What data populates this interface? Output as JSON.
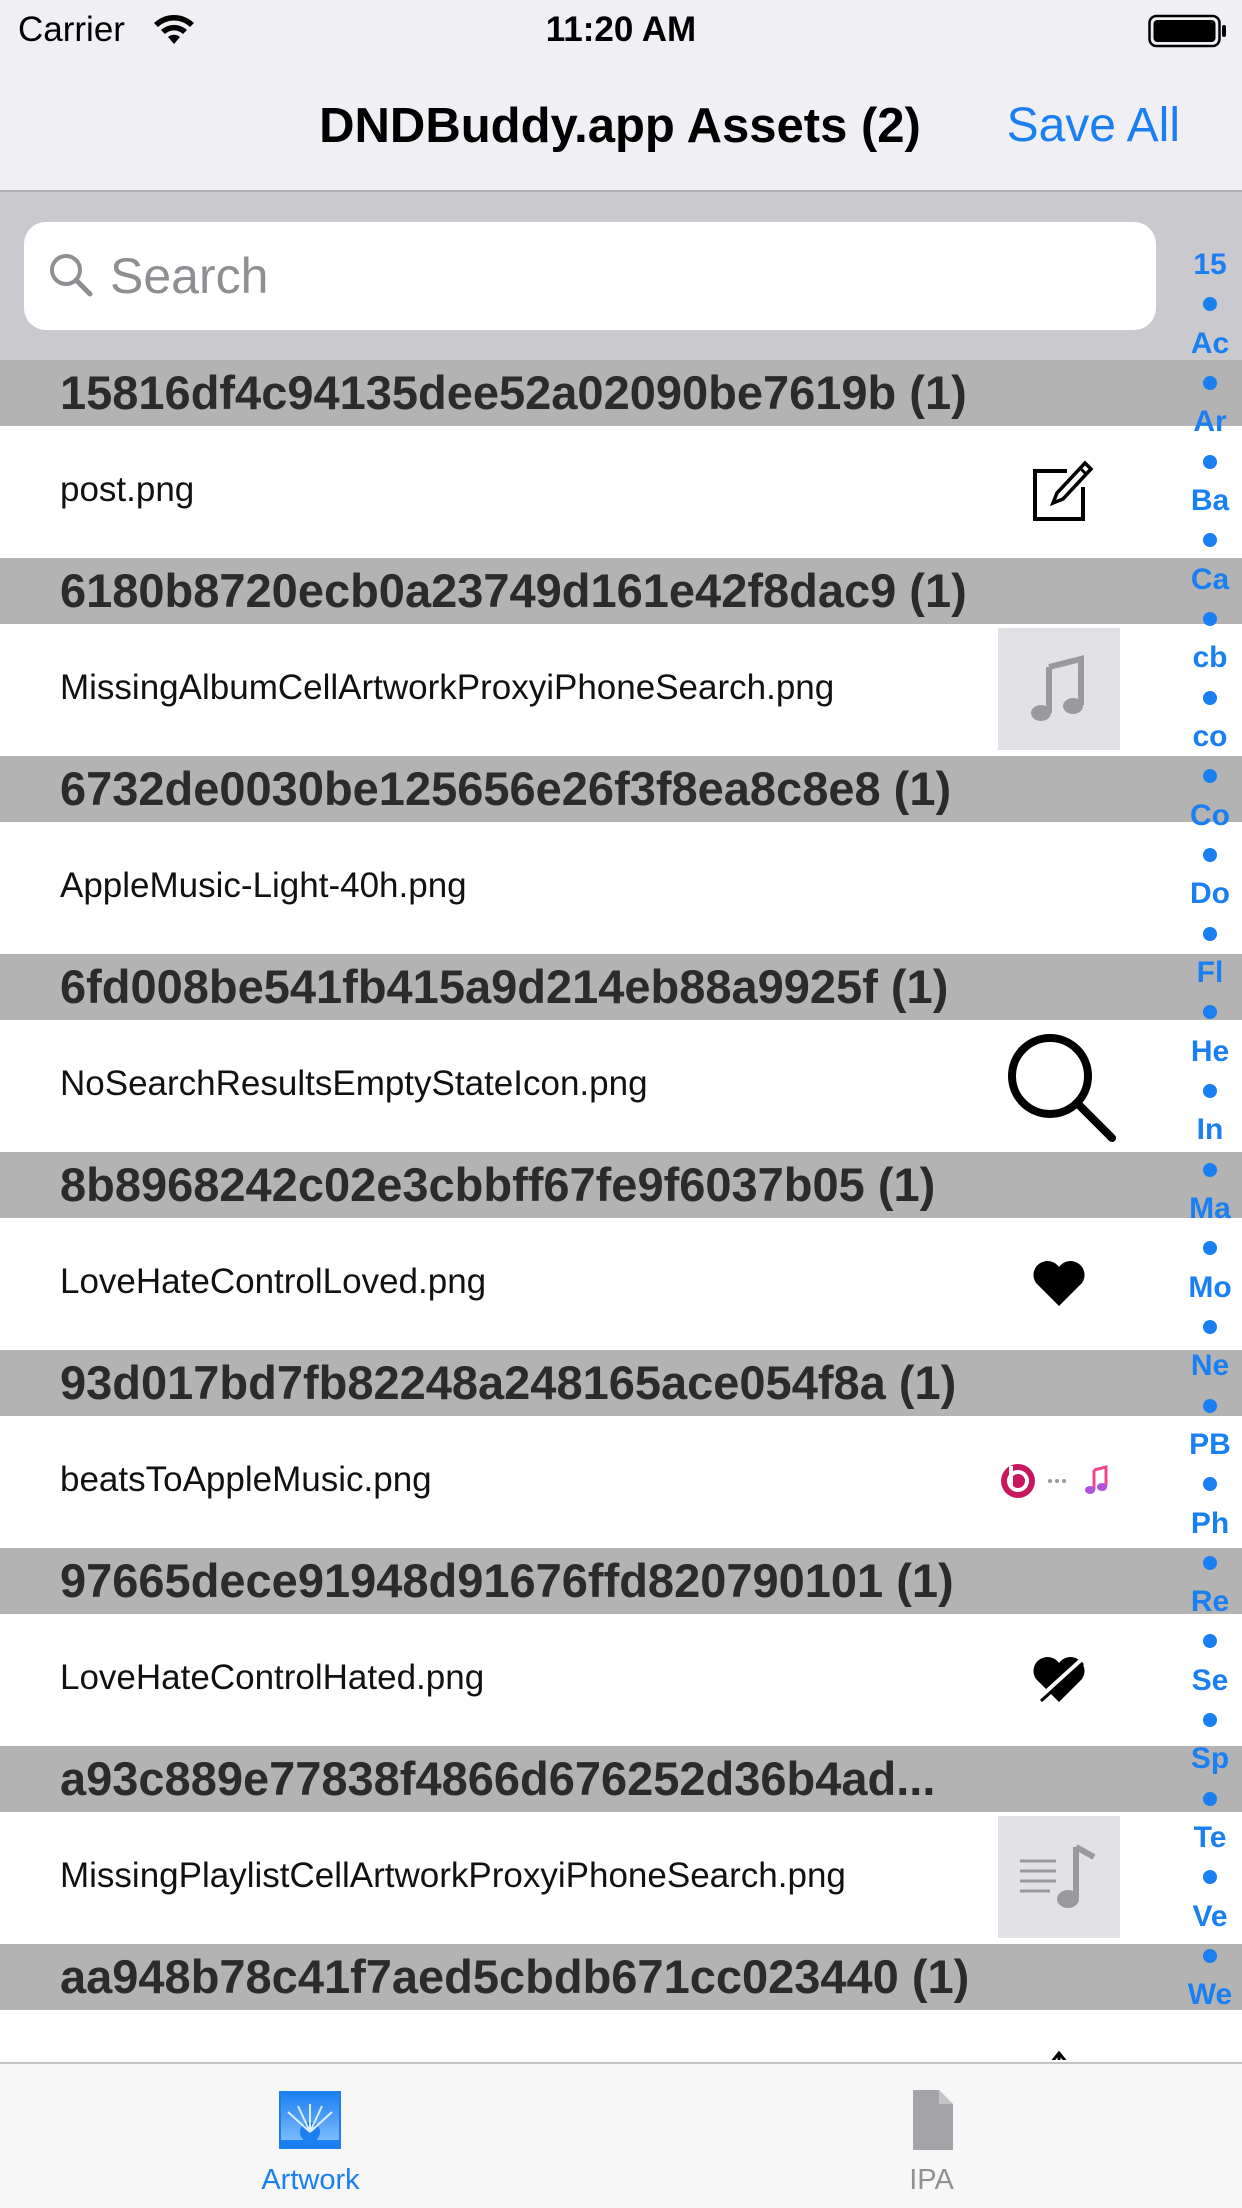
{
  "status_bar": {
    "carrier": "Carrier",
    "time": "11:20 AM"
  },
  "nav": {
    "title": "DNDBuddy.app Assets (2)",
    "action": "Save All"
  },
  "search": {
    "placeholder": "Search",
    "value": ""
  },
  "sections": [
    {
      "header": "15816df4c94135dee52a02090be7619b (1)",
      "item": "post.png",
      "icon": "compose-icon"
    },
    {
      "header": "6180b8720ecb0a23749d161e42f8dac9 (1)",
      "item": "MissingAlbumCellArtworkProxyiPhoneSearch.png",
      "icon": "music-note-icon"
    },
    {
      "header": "6732de0030be125656e26f3f8ea8c8e8 (1)",
      "item": "AppleMusic-Light-40h.png",
      "icon": "none"
    },
    {
      "header": "6fd008be541fb415a9d214eb88a9925f (1)",
      "item": "NoSearchResultsEmptyStateIcon.png",
      "icon": "magnifier-icon"
    },
    {
      "header": "8b8968242c02e3cbbff67fe9f6037b05 (1)",
      "item": "LoveHateControlLoved.png",
      "icon": "heart-icon"
    },
    {
      "header": "93d017bd7fb82248a248165ace054f8a (1)",
      "item": "beatsToAppleMusic.png",
      "icon": "beats-to-music-icon"
    },
    {
      "header": "97665dece91948d91676ffd820790101 (1)",
      "item": "LoveHateControlHated.png",
      "icon": "broken-heart-icon"
    },
    {
      "header": "a93c889e77838f4866d676252d36b4ad...",
      "item": "MissingPlaylistCellArtworkProxyiPhoneSearch.png",
      "icon": "playlist-icon"
    },
    {
      "header": "aa948b78c41f7aed5cbdb671cc023440 (1)",
      "item": "",
      "icon": "upload-arrow-icon"
    }
  ],
  "index": [
    "15",
    "Ac",
    "Ar",
    "Ba",
    "Ca",
    "cb",
    "co",
    "Co",
    "Do",
    "Fl",
    "He",
    "In",
    "Ma",
    "Mo",
    "Ne",
    "PB",
    "Ph",
    "Re",
    "Se",
    "Sp",
    "Te",
    "Ve",
    "We"
  ],
  "tabs": [
    {
      "label": "Artwork",
      "icon": "artwork-icon",
      "active": true
    },
    {
      "label": "IPA",
      "icon": "document-icon",
      "active": false
    }
  ],
  "colors": {
    "accent": "#1a7ff0",
    "section_header": "#b3b3b3",
    "bar_background": "#efeff4"
  }
}
